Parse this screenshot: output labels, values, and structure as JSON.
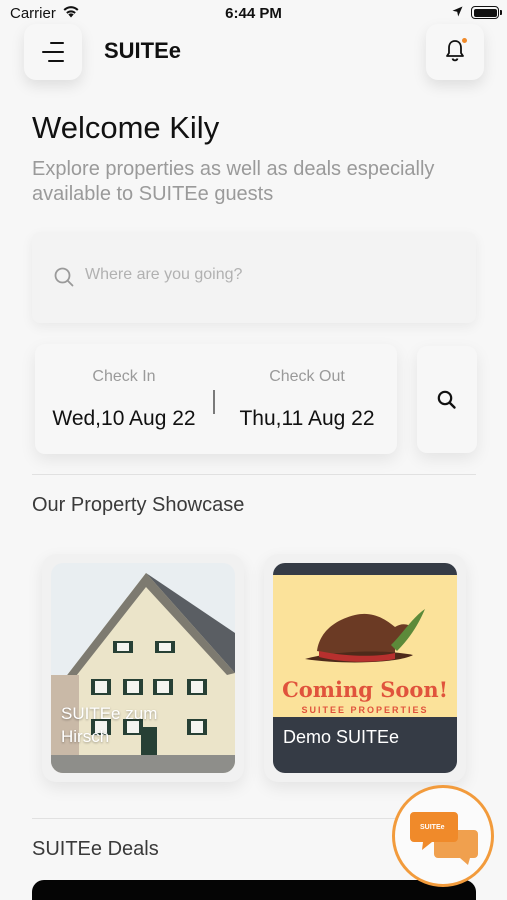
{
  "status_bar": {
    "carrier": "Carrier",
    "time": "6:44 PM"
  },
  "header": {
    "title": "SUITEe"
  },
  "welcome": {
    "title": "Welcome Kily",
    "subtitle": "Explore properties as well as deals especially available to SUITEe guests"
  },
  "search": {
    "placeholder": "Where are you going?"
  },
  "dates": {
    "check_in_label": "Check In",
    "check_in_value": "Wed,10 Aug 22",
    "check_out_label": "Check Out",
    "check_out_value": "Thu,11 Aug 22"
  },
  "showcase": {
    "title": "Our Property Showcase",
    "properties": [
      {
        "name": "SUITEe zum Hirsch"
      },
      {
        "name": "Demo SUITEe",
        "banner_title": "Coming Soon!",
        "banner_subtitle": "SUITEE PROPERTIES"
      }
    ]
  },
  "deals": {
    "title": "SUITEe Deals"
  },
  "chat": {
    "label": "SUITEe"
  },
  "colors": {
    "accent": "#f29b3c",
    "card_dark": "#353b45",
    "coming_soon_bg": "#fbe29a"
  }
}
